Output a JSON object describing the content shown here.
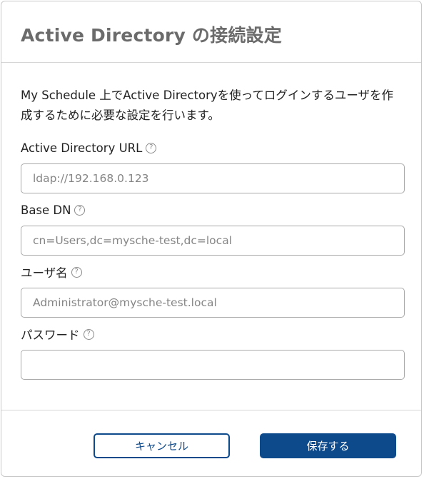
{
  "dialog": {
    "title": "Active Directory の接続設定",
    "description": "My Schedule 上でActive Directoryを使ってログインするユーザを作成するために必要な設定を行います。"
  },
  "fields": {
    "ad_url": {
      "label": "Active Directory URL",
      "placeholder": "ldap://192.168.0.123",
      "value": ""
    },
    "base_dn": {
      "label": "Base DN",
      "placeholder": "cn=Users,dc=mysche-test,dc=local",
      "value": ""
    },
    "username": {
      "label": "ユーザ名",
      "placeholder": "Administrator@mysche-test.local",
      "value": ""
    },
    "password": {
      "label": "パスワード",
      "placeholder": "",
      "value": ""
    }
  },
  "help_icon_glyph": "?",
  "buttons": {
    "cancel_label": "キャンセル",
    "save_label": "保存する"
  },
  "colors": {
    "primary": "#0d4a8c",
    "title_text": "#6b6b6b",
    "border": "#c9c9c9"
  }
}
